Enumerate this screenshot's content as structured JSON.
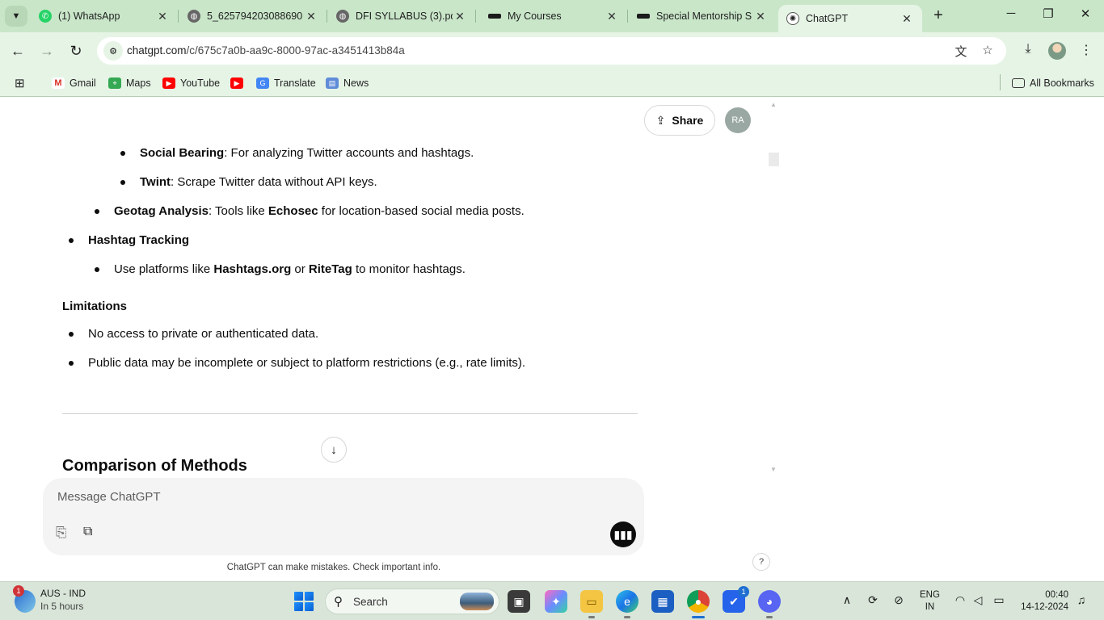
{
  "browser": {
    "tabs": [
      {
        "title": "(1) WhatsApp",
        "icon": "whatsapp-icon"
      },
      {
        "title": "5_625794203088690",
        "icon": "globe-icon"
      },
      {
        "title": "DFI SYLLABUS (3).pdf",
        "icon": "globe-icon"
      },
      {
        "title": "My Courses",
        "icon": "courses-icon"
      },
      {
        "title": "Special Mentorship S",
        "icon": "mentorship-icon"
      },
      {
        "title": "ChatGPT",
        "icon": "chatgpt-icon",
        "active": true
      }
    ],
    "url_host": "chatgpt.com",
    "url_path": "/c/675c7a0b-aa9c-8000-97ac-a3451413b84a",
    "bookmarks": [
      "Gmail",
      "Maps",
      "YouTube",
      "",
      "Translate",
      "News"
    ],
    "all_bookmarks_label": "All Bookmarks",
    "accent_color": "#c9e6c9"
  },
  "chat": {
    "share_label": "Share",
    "user_initials": "RA",
    "lines": {
      "l1_bold": "Social Bearing",
      "l1_rest": ": For analyzing Twitter accounts and hashtags.",
      "l2_bold": "Twint",
      "l2_rest": ": Scrape Twitter data without API keys.",
      "l3_bold": "Geotag Analysis",
      "l3_mid": ": Tools like ",
      "l3_bold2": "Echosec",
      "l3_rest": " for location-based social media posts.",
      "l4_bold": "Hashtag Tracking",
      "l5_pre": "Use platforms like ",
      "l5_bold": "Hashtags.org",
      "l5_mid": " or ",
      "l5_bold2": "RiteTag",
      "l5_rest": " to monitor hashtags.",
      "limitations": "Limitations",
      "l6": "No access to private or authenticated data.",
      "l7": "Public data may be incomplete or subject to platform restrictions (e.g., rate limits).",
      "comparison": "Comparison of Methods"
    },
    "composer_placeholder": "Message ChatGPT",
    "disclaimer": "ChatGPT can make mistakes. Check important info.",
    "help_label": "?"
  },
  "taskbar": {
    "weather_badge": "1",
    "weather_title": "AUS - IND",
    "weather_sub": "In 5 hours",
    "search_label": "Search",
    "todo_badge": "1",
    "lang_top": "ENG",
    "lang_bottom": "IN",
    "time": "00:40",
    "date": "14-12-2024"
  }
}
